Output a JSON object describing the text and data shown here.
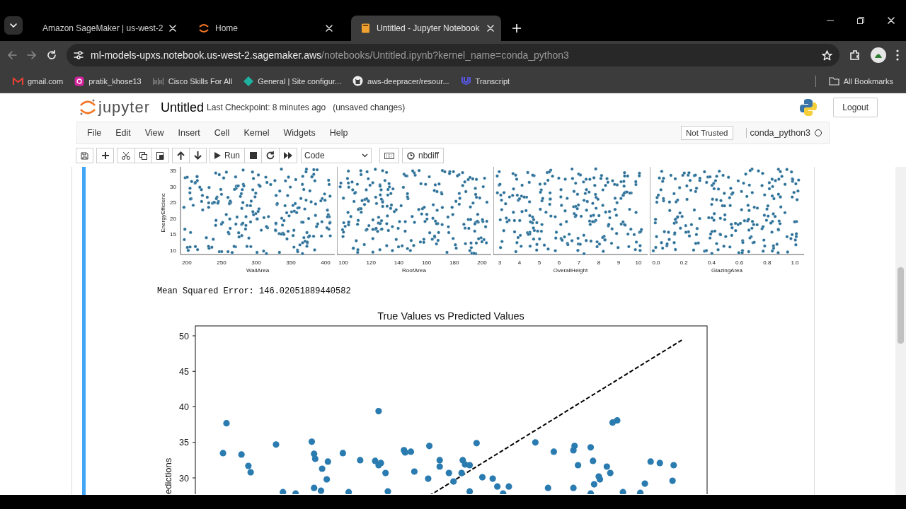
{
  "browser": {
    "tabs": [
      {
        "title": "Amazon SageMaker | us-west-2",
        "kind": "sagemaker",
        "selected": false
      },
      {
        "title": "Home",
        "kind": "jupyter",
        "selected": false
      },
      {
        "title": "Untitled - Jupyter Notebook",
        "kind": "notebook",
        "selected": true
      }
    ],
    "url": {
      "host": "ml-models-upxs.notebook.us-west-2.sagemaker.aws",
      "path": "/notebooks/Untitled.ipynb?kernel_name=conda_python3"
    },
    "bookmarks": [
      {
        "label": "gmail.com",
        "kind": "gmail"
      },
      {
        "label": "pratik_khose13",
        "kind": "instagram"
      },
      {
        "label": "Cisco Skills For All",
        "kind": "cisco"
      },
      {
        "label": "General | Site configur...",
        "kind": "diamond"
      },
      {
        "label": "aws-deepracer/resour...",
        "kind": "github"
      },
      {
        "label": "Transcript",
        "kind": "transcript"
      }
    ],
    "all_bookmarks": "All Bookmarks"
  },
  "jupyter": {
    "logo_text": "jupyter",
    "notebook_name": "Untitled",
    "checkpoint": "Last Checkpoint: 8 minutes ago",
    "save_status": "(unsaved changes)",
    "logout": "Logout",
    "menu": [
      "File",
      "Edit",
      "View",
      "Insert",
      "Cell",
      "Kernel",
      "Widgets",
      "Help"
    ],
    "trust": "Not Trusted",
    "kernel": "conda_python3",
    "kernel_busy": false,
    "toolbar": {
      "run": "Run",
      "cell_type": "Code",
      "nbdiff": "nbdiff"
    }
  },
  "output": {
    "pairplot": {
      "ylabel": "EnergyEfficienc",
      "yticks": [
        "35",
        "30",
        "25",
        "20",
        "15",
        "10"
      ],
      "panels": [
        {
          "xlabel": "WallArea",
          "xticks": [
            "200",
            "250",
            "300",
            "350",
            "400"
          ]
        },
        {
          "xlabel": "RoofArea",
          "xticks": [
            "100",
            "120",
            "140",
            "160",
            "180",
            "200"
          ]
        },
        {
          "xlabel": "OverallHeight",
          "xticks": [
            "3",
            "4",
            "5",
            "6",
            "7",
            "8",
            "9",
            "10"
          ]
        },
        {
          "xlabel": "GlazingArea",
          "xticks": [
            "0.0",
            "0.2",
            "0.4",
            "0.6",
            "0.8",
            "1.0"
          ]
        }
      ]
    },
    "mse": "Mean Squared Error: 146.02051889440582",
    "main_plot": {
      "title": "True Values vs Predicted Values",
      "ylabel": "edictions",
      "yticks": [
        "50",
        "45",
        "40",
        "35",
        "30"
      ]
    }
  }
}
